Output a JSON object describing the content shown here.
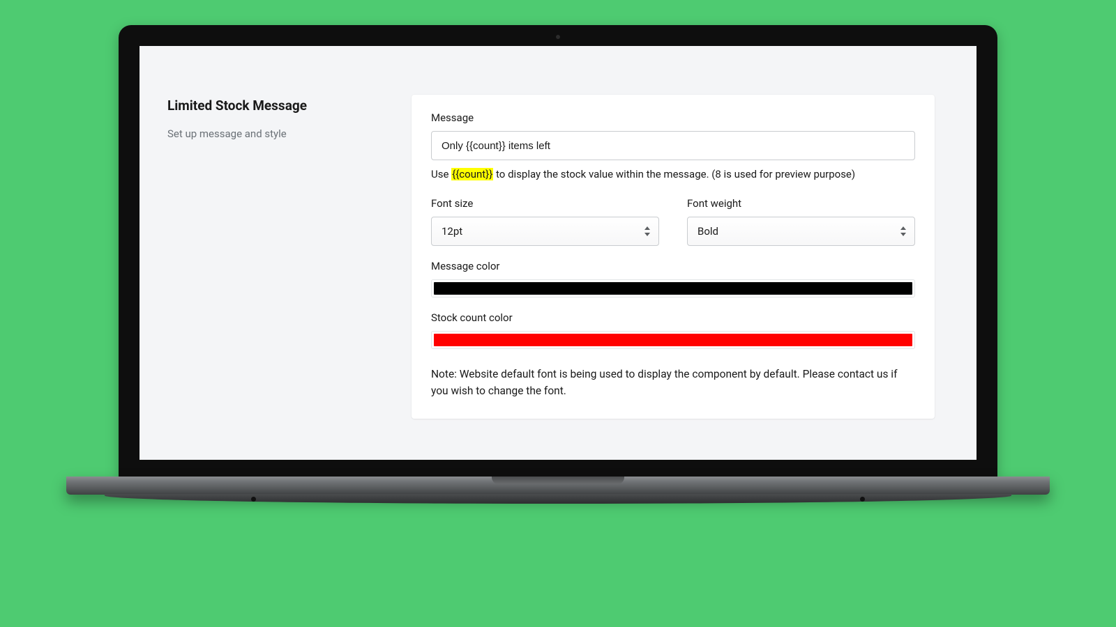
{
  "sidebar": {
    "title": "Limited Stock Message",
    "subtitle": "Set up message and style"
  },
  "form": {
    "message_label": "Message",
    "message_value": "Only {{count}} items left",
    "helper_prefix": "Use ",
    "helper_token": "{{count}}",
    "helper_suffix": " to display the stock value within the message. (8 is used for preview purpose)",
    "font_size_label": "Font size",
    "font_size_value": "12pt",
    "font_weight_label": "Font weight",
    "font_weight_value": "Bold",
    "message_color_label": "Message color",
    "message_color_value": "#000000",
    "stock_color_label": "Stock count color",
    "stock_color_value": "#ff0000",
    "note": "Note: Website default font is being used to display the component by default. Please contact us if you wish to change the font."
  }
}
